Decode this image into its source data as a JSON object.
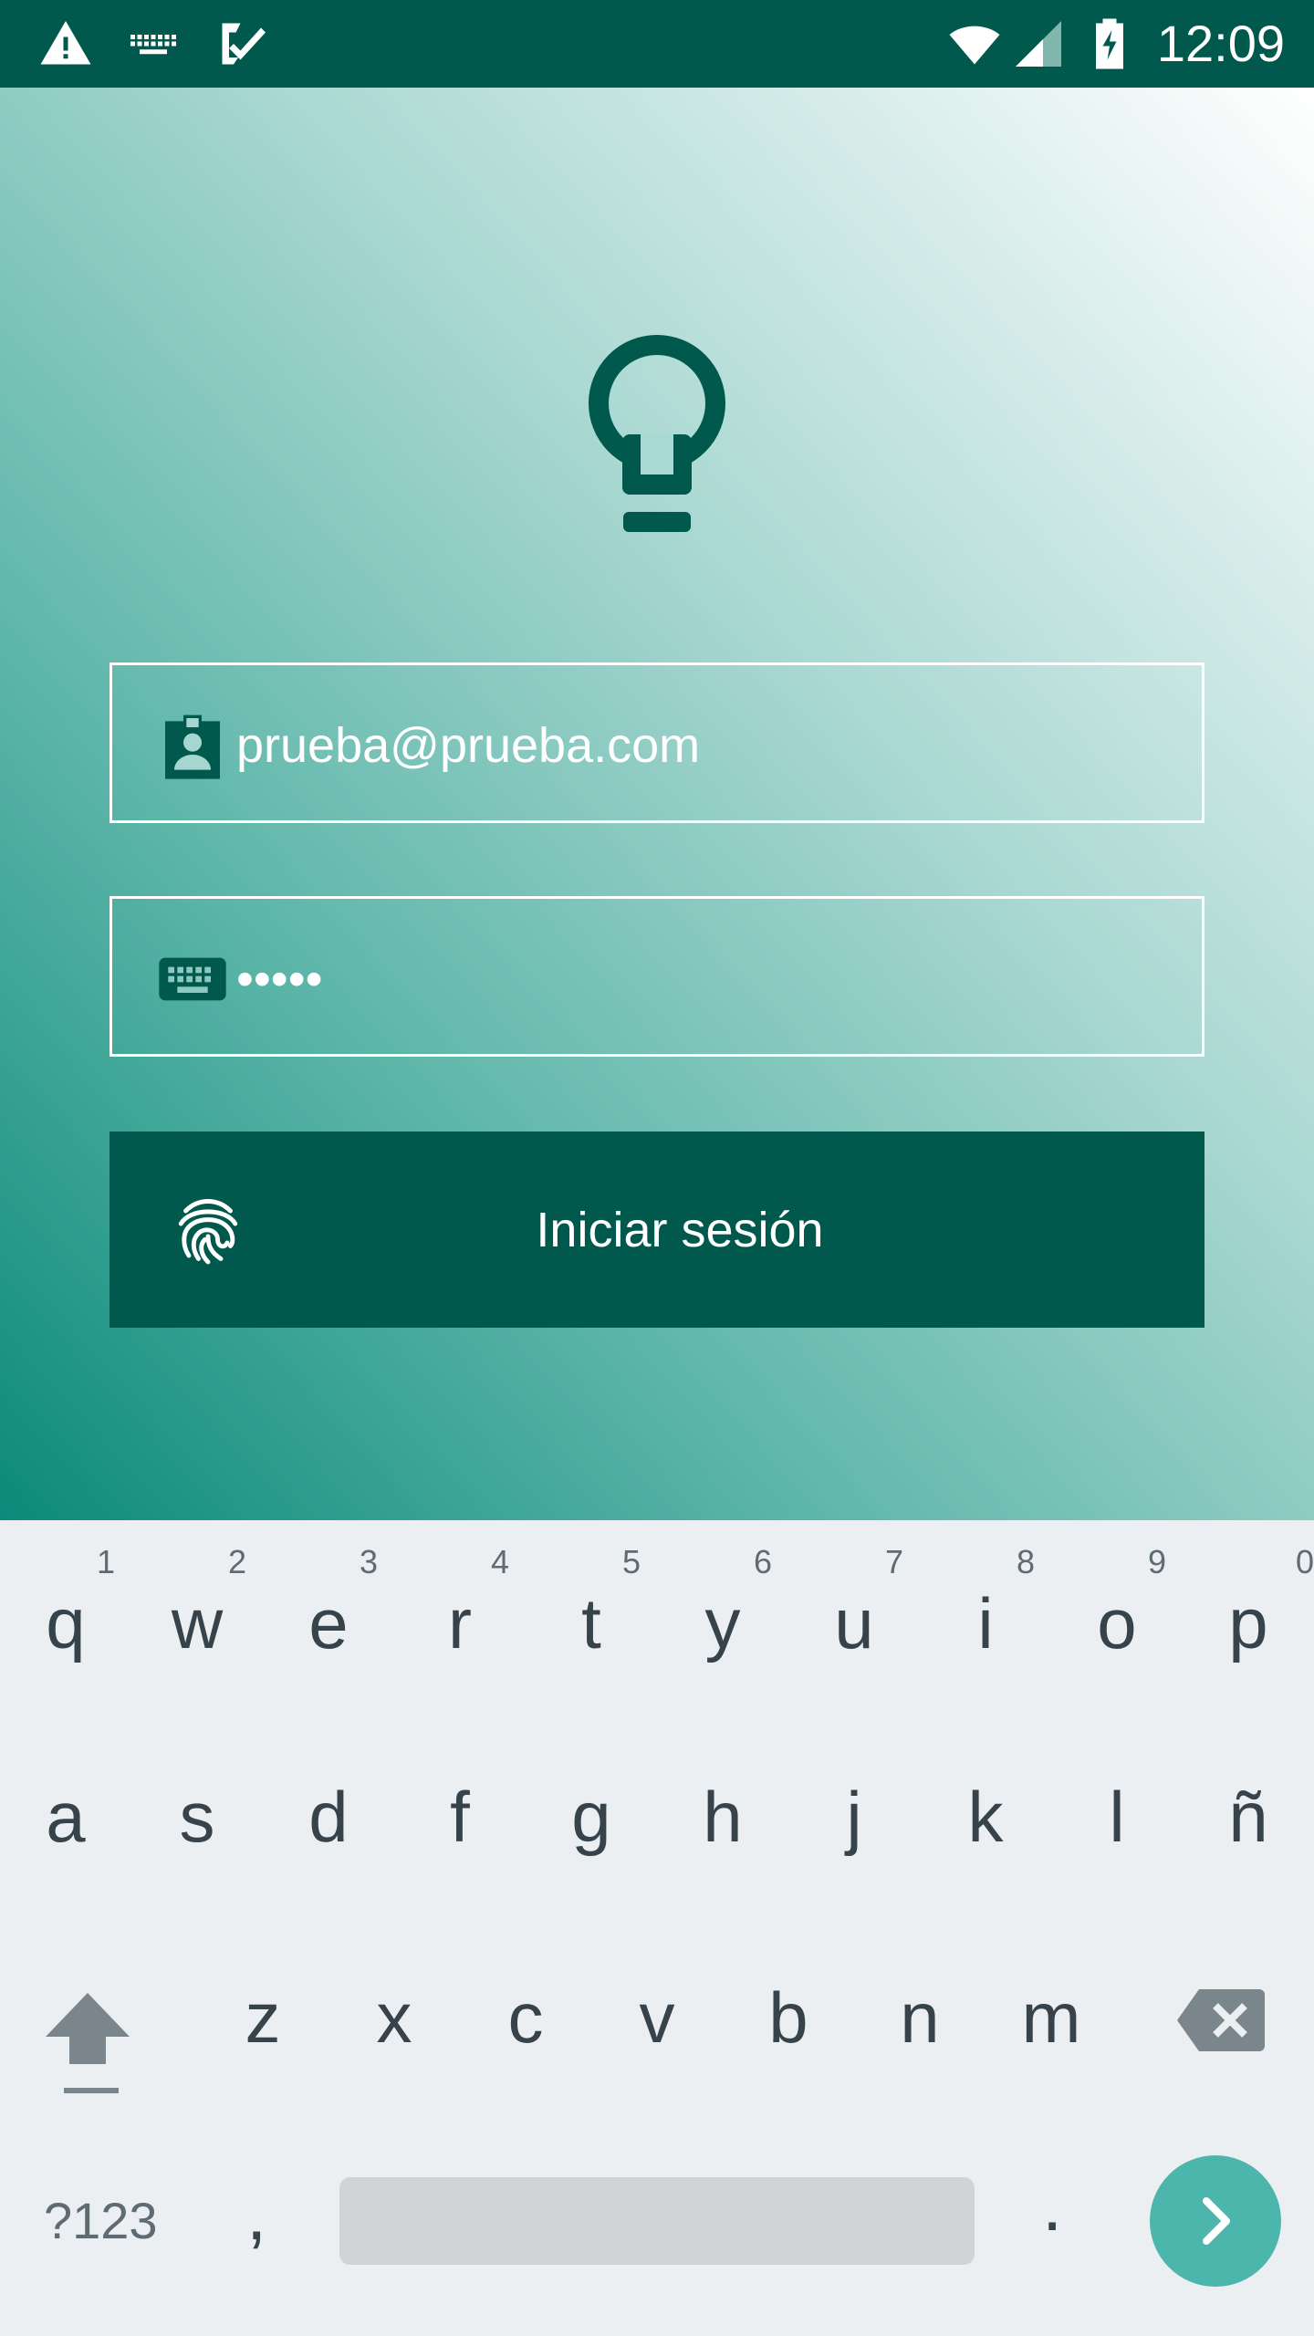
{
  "status_bar": {
    "time": "12:09",
    "left_icons": [
      "warning-icon",
      "keyboard-icon",
      "check-app-icon"
    ],
    "right_icons": [
      "wifi-icon",
      "signal-icon",
      "battery-charging-icon"
    ],
    "background": "#00594c"
  },
  "login": {
    "logo": "lightbulb-icon",
    "email": {
      "icon": "contact-badge-icon",
      "value": "prueba@prueba.com"
    },
    "password": {
      "icon": "keyboard-icon",
      "value": "•••••"
    },
    "button": {
      "icon": "fingerprint-icon",
      "label": "Iniciar sesión"
    },
    "accent": "#00594c"
  },
  "keyboard": {
    "row1": [
      {
        "ch": "q",
        "hint": "1"
      },
      {
        "ch": "w",
        "hint": "2"
      },
      {
        "ch": "e",
        "hint": "3"
      },
      {
        "ch": "r",
        "hint": "4"
      },
      {
        "ch": "t",
        "hint": "5"
      },
      {
        "ch": "y",
        "hint": "6"
      },
      {
        "ch": "u",
        "hint": "7"
      },
      {
        "ch": "i",
        "hint": "8"
      },
      {
        "ch": "o",
        "hint": "9"
      },
      {
        "ch": "p",
        "hint": "0"
      }
    ],
    "row2": [
      "a",
      "s",
      "d",
      "f",
      "g",
      "h",
      "j",
      "k",
      "l",
      "ñ"
    ],
    "row3": [
      "z",
      "x",
      "c",
      "v",
      "b",
      "n",
      "m"
    ],
    "symbols_label": "?123",
    "comma": ",",
    "period": ".",
    "enter_color": "#4db6ac"
  }
}
